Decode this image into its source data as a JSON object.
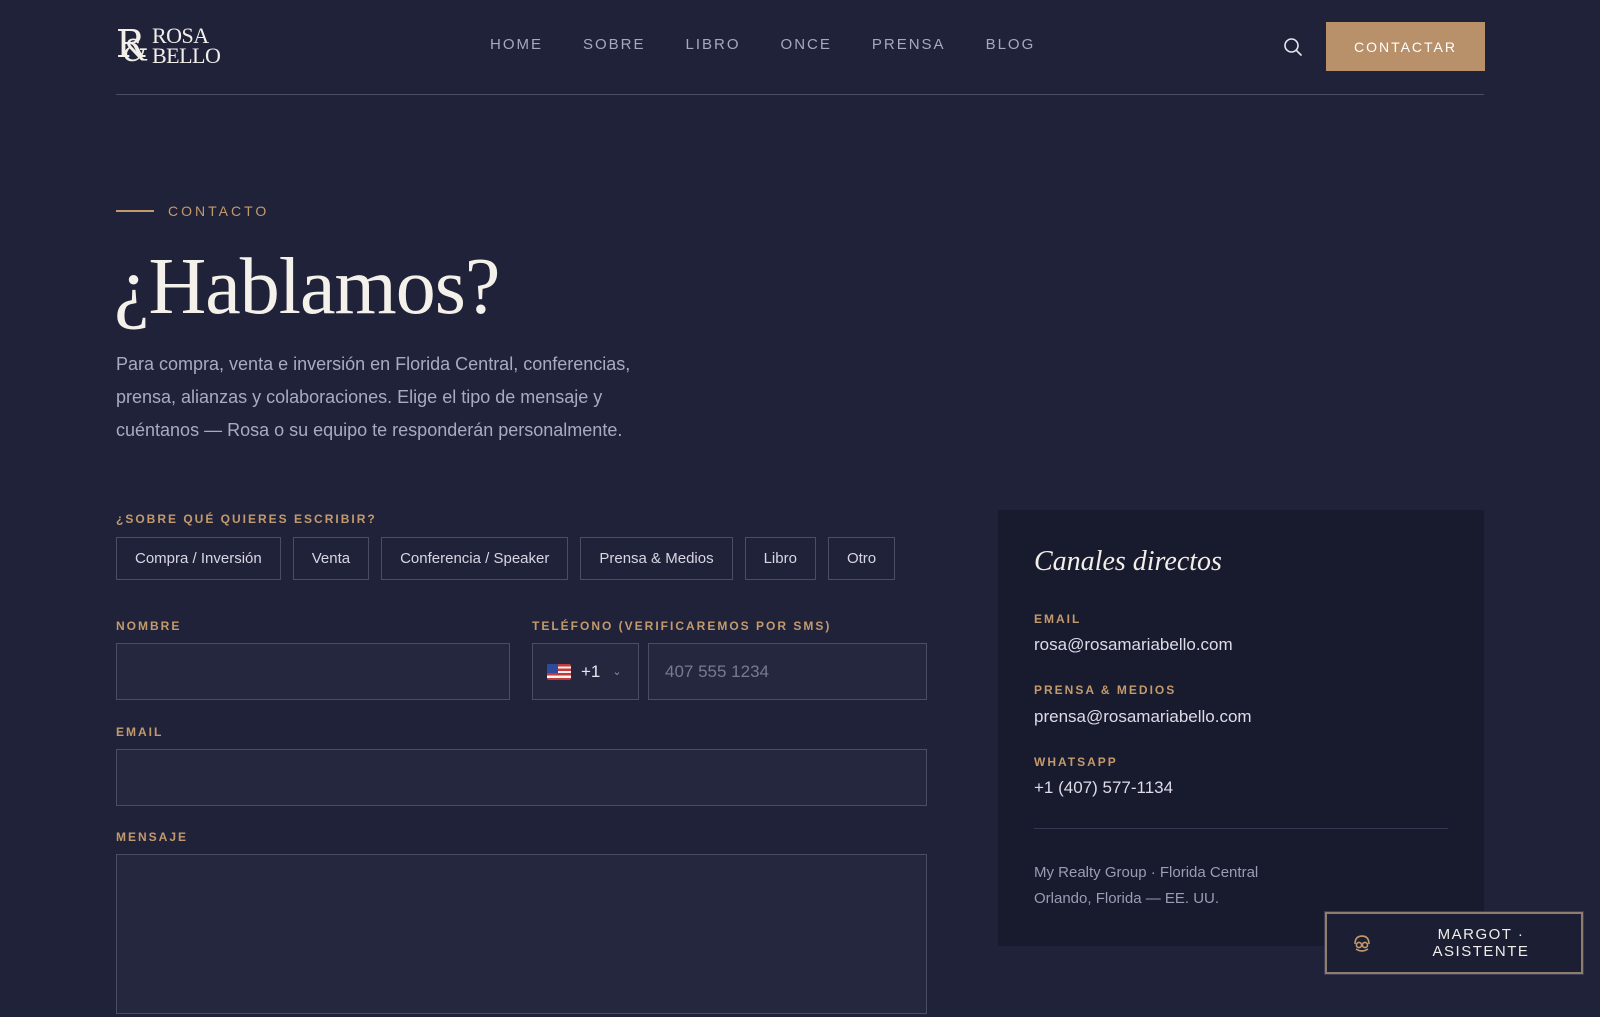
{
  "logo": {
    "line1": "ROSA",
    "line2": "BELLO",
    "monogram": "R",
    "ampersand": "&"
  },
  "nav": [
    {
      "label": "HOME"
    },
    {
      "label": "SOBRE"
    },
    {
      "label": "LIBRO"
    },
    {
      "label": "ONCE"
    },
    {
      "label": "PRENSA"
    },
    {
      "label": "BLOG"
    }
  ],
  "header": {
    "search_icon": "search-icon",
    "contact_label": "CONTACTAR"
  },
  "hero": {
    "eyebrow": "CONTACTO",
    "title": "¿Hablamos?",
    "intro": "Para compra, venta e inversión en Florida Central, conferencias, prensa, alianzas y colaboraciones. Elige el tipo de mensaje y cuéntanos — Rosa o su equipo te responderán personalmente."
  },
  "form": {
    "topic_label": "¿SOBRE QUÉ QUIERES ESCRIBIR?",
    "topics": [
      "Compra / Inversión",
      "Venta",
      "Conferencia / Speaker",
      "Prensa & Medios",
      "Libro",
      "Otro"
    ],
    "name_label": "NOMBRE",
    "name_value": "",
    "phone_label": "TELÉFONO (VERIFICAREMOS POR SMS)",
    "country_code": "+1",
    "phone_value": "",
    "phone_placeholder": "407 555 1234",
    "email_label": "EMAIL",
    "email_value": "",
    "message_label": "MENSAJE",
    "message_value": ""
  },
  "channels": {
    "title": "Canales directos",
    "email_label": "EMAIL",
    "email_value": "rosa@rosamariabello.com",
    "press_label": "PRENSA & MEDIOS",
    "press_value": "prensa@rosamariabello.com",
    "whatsapp_label": "WHATSAPP",
    "whatsapp_value": "+1 (407) 577-1134",
    "address_line1": "My Realty Group · Florida Central",
    "address_line2": "Orlando, Florida — EE. UU."
  },
  "assistant": {
    "label": "MARGOT · ASISTENTE",
    "icon": "assistant-icon"
  },
  "colors": {
    "background": "#20223a",
    "accent": "#b8916a",
    "panel": "#181a2e"
  }
}
